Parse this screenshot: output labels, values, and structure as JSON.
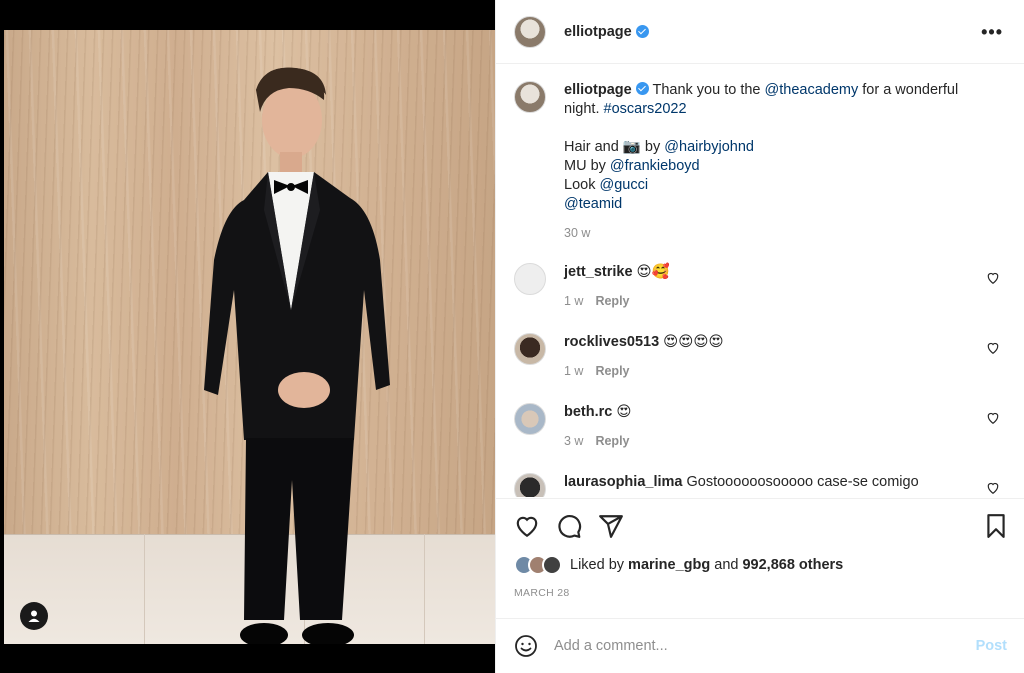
{
  "post": {
    "author": "elliotpage",
    "more_icon": "more-horizontal-icon",
    "caption": {
      "author": "elliotpage",
      "line1_a": "Thank you to the ",
      "mention_academy": "@theacademy",
      "line1_b": " for a wonderful night. ",
      "hashtag": "#oscars2022",
      "hair_a": "Hair and ",
      "camera_emoji": "📷",
      "hair_b": " by ",
      "mention_hair": "@hairbyjohnd",
      "mu_a": "MU by ",
      "mention_mu": "@frankieboyd",
      "look_a": "Look ",
      "mention_gucci": "@gucci",
      "mention_team": "@teamid",
      "age": "30 w"
    },
    "comments": [
      {
        "user": "jett_strike",
        "text": "😍🥰",
        "age": "1 w",
        "reply": "Reply"
      },
      {
        "user": "rocklives0513",
        "text": "😍😍😍😍",
        "age": "1 w",
        "reply": "Reply"
      },
      {
        "user": "beth.rc",
        "text": "😍",
        "age": "3 w",
        "reply": "Reply"
      },
      {
        "user": "laurasophia_lima",
        "text": "Gostoooooosooooo case-se comigo"
      }
    ],
    "likes": {
      "prefix": "Liked by ",
      "user": "marine_gbg",
      "middle": " and ",
      "count": "992,868 others"
    },
    "date": "MARCH 28",
    "add_comment": {
      "placeholder": "Add a comment...",
      "post_label": "Post"
    }
  },
  "colors": {
    "link": "#00376b",
    "verified": "#3897f0",
    "muted": "#8e8e8e",
    "post_disabled": "#b2dffc"
  }
}
